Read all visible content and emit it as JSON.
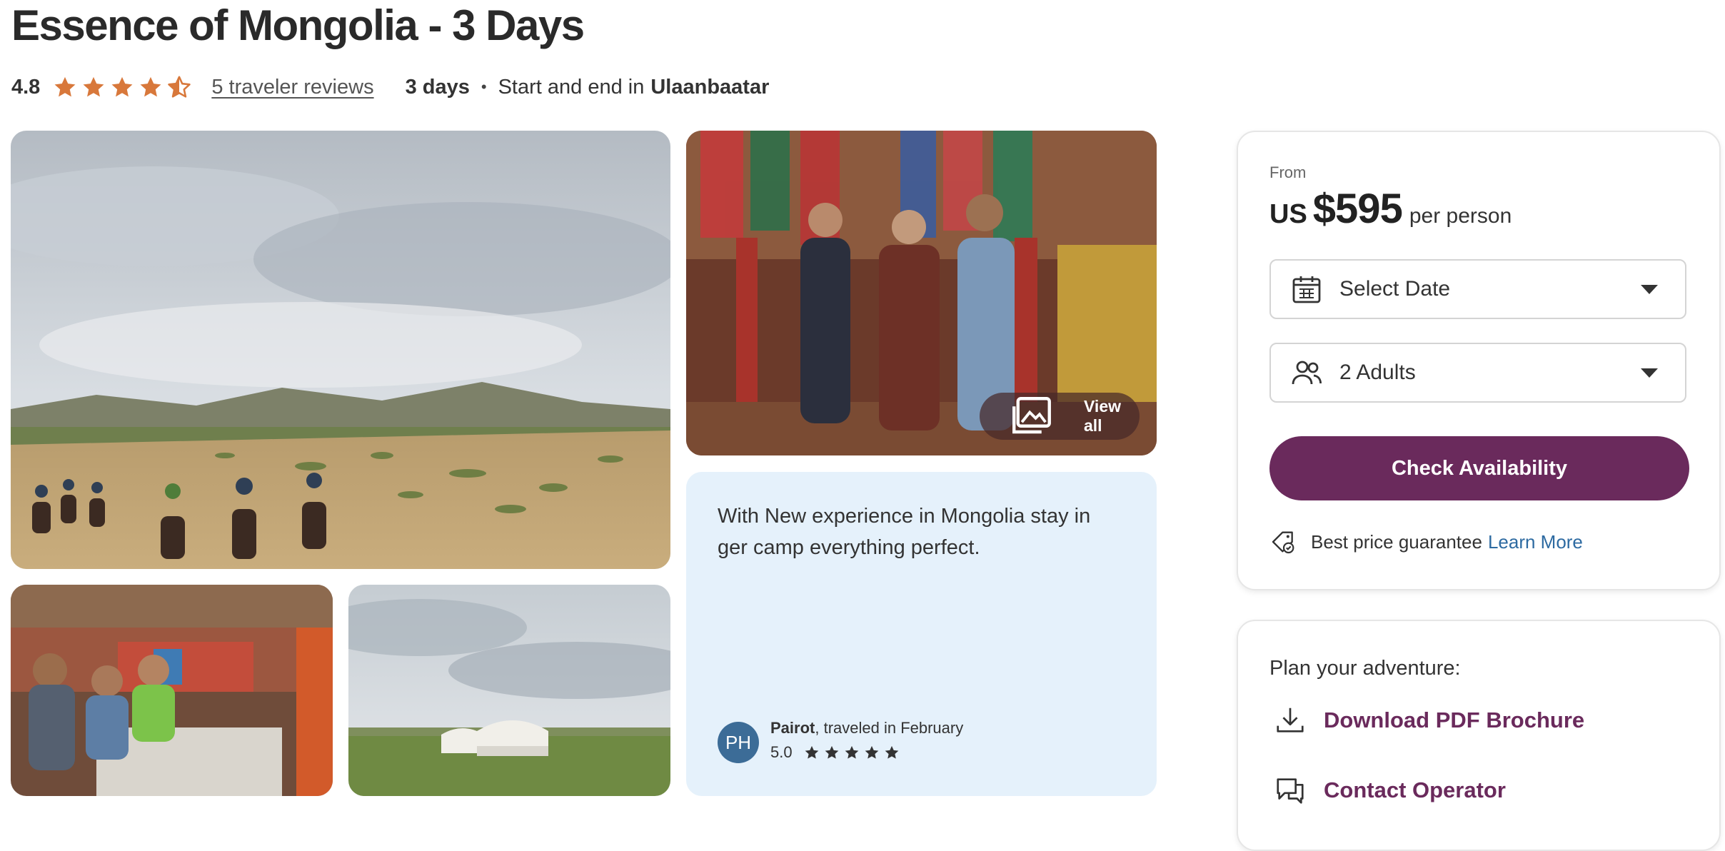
{
  "tour": {
    "title": "Essence of Mongolia - 3 Days",
    "rating": "4.8",
    "rating_value": 4.5,
    "reviews_link": "5 traveler reviews",
    "duration": "3 days",
    "dot": "•",
    "start_end_prefix": "Start and end in",
    "city": "Ulaanbaatar"
  },
  "gallery": {
    "view_all_label": "View all"
  },
  "review": {
    "text": "With New experience in Mongolia stay in ger camp everything perfect.",
    "initials": "PH",
    "reviewer": "Pairot",
    "traveled": ", traveled in February",
    "score": "5.0",
    "stars": 5
  },
  "booking": {
    "from_label": "From",
    "currency": "US",
    "price": "$595",
    "per": "per person",
    "date_select": "Select Date",
    "travelers_select": "2 Adults",
    "check_button": "Check Availability",
    "guarantee_text": "Best price guarantee",
    "learn_more": "Learn More"
  },
  "plan": {
    "heading": "Plan your adventure:",
    "download": "Download PDF Brochure",
    "contact": "Contact Operator"
  },
  "colors": {
    "star": "#d8783b",
    "brand": "#6a2a5c",
    "link": "#2d6aa1",
    "review_bg": "#e5f1fb",
    "avatar": "#3c6c97"
  },
  "icons": [
    "star-icon",
    "image-gallery-icon",
    "calendar-icon",
    "people-icon",
    "chevron-down-icon",
    "price-tag-check-icon",
    "download-icon",
    "chat-icon"
  ]
}
